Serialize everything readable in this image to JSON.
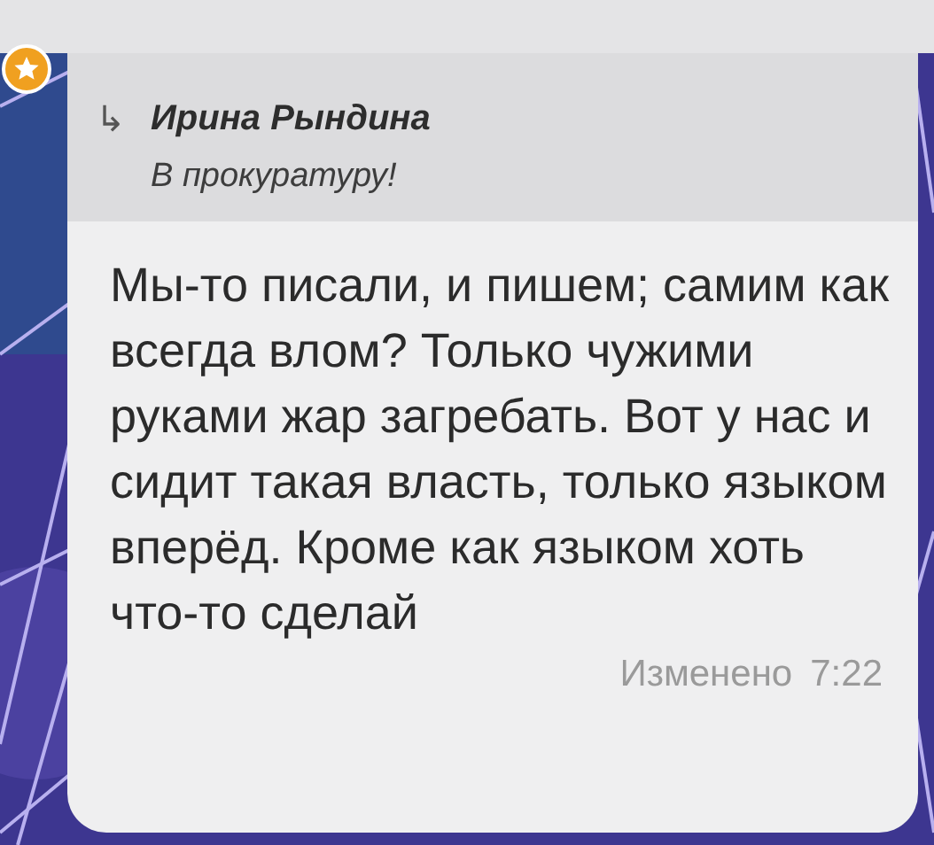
{
  "message": {
    "reply": {
      "icon": "↳",
      "author": "Ирина Рындина",
      "text": "В прокуратуру!"
    },
    "text": "Мы-то писали, и пишем; самим как всегда влом? Только чужими руками жар загребать. Вот у нас и сидит такая власть, только языком вперёд. Кроме как языком хоть что-то сделай",
    "edited": "Изменено",
    "time": "7:22"
  }
}
